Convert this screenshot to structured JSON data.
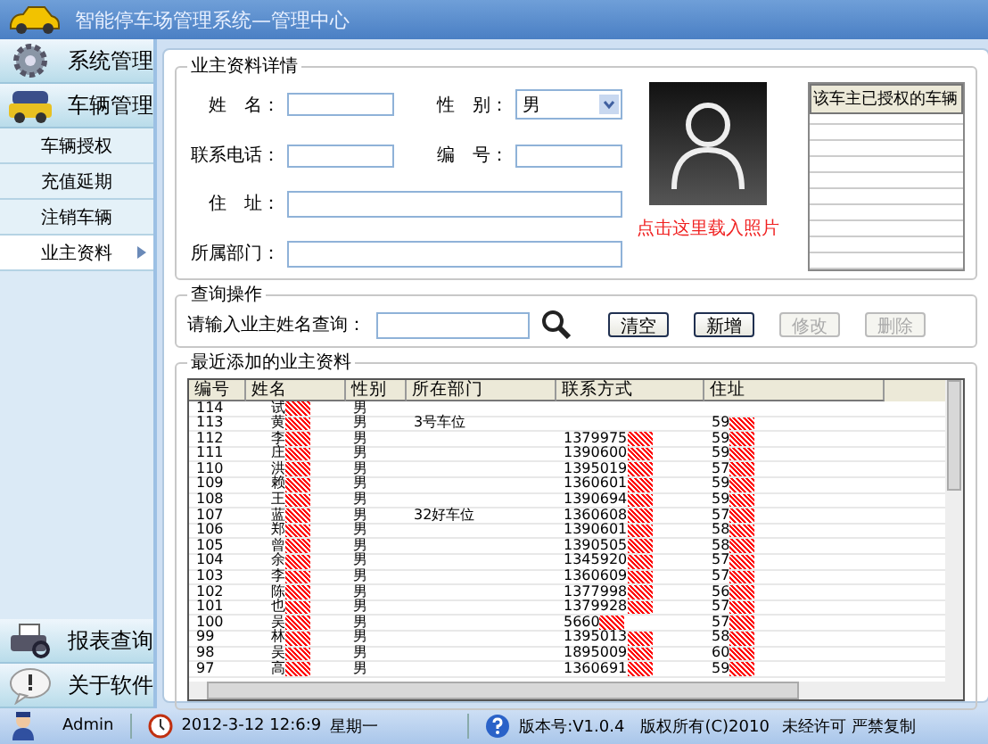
{
  "window": {
    "title": "智能停车场管理系统—管理中心"
  },
  "sidebar": {
    "top": [
      {
        "label": "系统管理",
        "kind": "gear"
      },
      {
        "label": "车辆管理",
        "kind": "car"
      }
    ],
    "items": [
      {
        "label": "车辆授权",
        "selected": false
      },
      {
        "label": "充值延期",
        "selected": false
      },
      {
        "label": "注销车辆",
        "selected": false
      },
      {
        "label": "业主资料",
        "selected": true
      }
    ],
    "bottom": [
      {
        "label": "报表查询",
        "kind": "printer"
      },
      {
        "label": "关于软件",
        "kind": "info"
      }
    ]
  },
  "details": {
    "title": "业主资料详情",
    "name_label": "姓　名：",
    "phone_label": "联系电话：",
    "address_label": "住　址：",
    "dept_label": "所属部门：",
    "gender_label": "性　别：",
    "gender": "男",
    "number_label": "编　号：",
    "photo_link": "点击这里载入照片",
    "vehicles_header": "该车主已授权的车辆"
  },
  "query": {
    "title": "查询操作",
    "label": "请输入业主姓名查询：",
    "buttons": [
      {
        "label": "清空",
        "disabled": false
      },
      {
        "label": "新增",
        "disabled": false
      },
      {
        "label": "修改",
        "disabled": true
      },
      {
        "label": "删除",
        "disabled": true
      }
    ]
  },
  "table": {
    "title": "最近添加的业主资料",
    "columns": [
      "编号",
      "姓名",
      "性别",
      "所在部门",
      "联系方式",
      "住址"
    ],
    "rows": [
      [
        "114",
        "试",
        "男",
        "",
        "",
        ""
      ],
      [
        "113",
        "黄",
        "男",
        "3号车位",
        "",
        "59"
      ],
      [
        "112",
        "李",
        "男",
        "",
        "1379975",
        "59"
      ],
      [
        "111",
        "庄",
        "男",
        "",
        "1390600",
        "59"
      ],
      [
        "110",
        "洪",
        "男",
        "",
        "1395019",
        "57"
      ],
      [
        "109",
        "赖",
        "男",
        "",
        "1360601",
        "59"
      ],
      [
        "108",
        "王",
        "男",
        "",
        "1390694",
        "59"
      ],
      [
        "107",
        "蓝",
        "男",
        "32好车位",
        "1360608",
        "57"
      ],
      [
        "106",
        "郑",
        "男",
        "",
        "1390601",
        "58"
      ],
      [
        "105",
        "曾",
        "男",
        "",
        "1390505",
        "58"
      ],
      [
        "104",
        "余",
        "男",
        "",
        "1345920",
        "57"
      ],
      [
        "103",
        "李",
        "男",
        "",
        "1360609",
        "57"
      ],
      [
        "102",
        "陈",
        "男",
        "",
        "1377998",
        "56"
      ],
      [
        "101",
        "也",
        "男",
        "",
        "1379928",
        "57"
      ],
      [
        "100",
        "吴",
        "男",
        "",
        "5660",
        "57"
      ],
      [
        "99",
        "林",
        "男",
        "",
        "1395013",
        "58"
      ],
      [
        "98",
        "吴",
        "男",
        "",
        "1895009",
        "60"
      ],
      [
        "97",
        "高",
        "男",
        "",
        "1360691",
        "59"
      ]
    ]
  },
  "status_bar": {
    "user": "Admin",
    "datetime": "2012-3-12 12:6:9",
    "weekday": "星期一",
    "version": "版本号:V1.0.4",
    "copyright": "版权所有(C)2010",
    "notice": "未经许可 严禁复制"
  }
}
